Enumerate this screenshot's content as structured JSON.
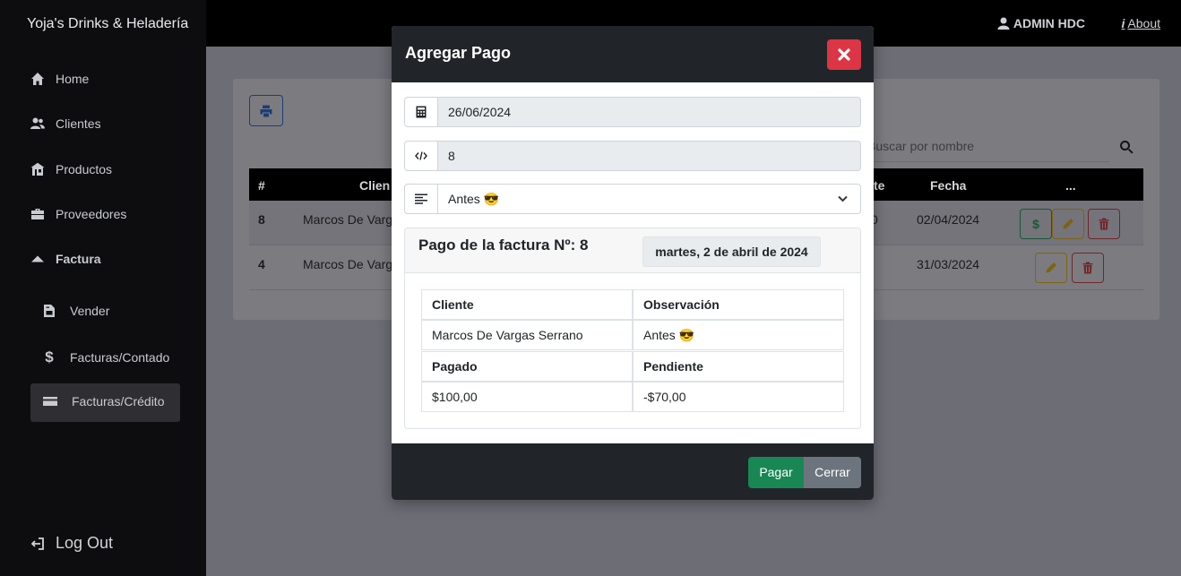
{
  "app": {
    "brand": "Yoja's Drinks & Heladería"
  },
  "topbar": {
    "user": "ADMIN HDC",
    "about": "About"
  },
  "sidebar": {
    "items": [
      {
        "label": "Home",
        "icon": "home-icon"
      },
      {
        "label": "Clientes",
        "icon": "users-icon"
      },
      {
        "label": "Productos",
        "icon": "store-icon"
      },
      {
        "label": "Proveedores",
        "icon": "briefcase-icon"
      },
      {
        "label": "Factura",
        "icon": "caret-up-icon"
      }
    ],
    "subitems": [
      {
        "label": "Vender",
        "icon": "file-invoice-icon"
      },
      {
        "label": "Facturas/Contado",
        "icon": "dollar-icon"
      },
      {
        "label": "Facturas/Crédito",
        "icon": "credit-card-icon",
        "active": true
      }
    ],
    "logout": "Log Out"
  },
  "background": {
    "search_placeholder": "Buscar por nombre",
    "columns": {
      "num": "#",
      "client": "Clien",
      "amount": "te",
      "date": "Fecha",
      "actions": "..."
    },
    "rows": [
      {
        "num": "8",
        "client": "Marcos De Varg",
        "amount": "0",
        "date": "02/04/2024"
      },
      {
        "num": "4",
        "client": "Marcos De Varg",
        "date": "31/03/2024"
      }
    ],
    "pay_action_label": "$"
  },
  "modal": {
    "title": "Agregar Pago",
    "date_value": "26/06/2024",
    "code_value": "8",
    "observation_selected": "Antes 😎",
    "invoice_title": "Pago de la factura Nº: 8",
    "invoice_date": "martes, 2 de abril de 2024",
    "table": {
      "client_header": "Cliente",
      "observation_header": "Observación",
      "client_value": "Marcos De Vargas Serrano",
      "observation_value": "Antes 😎",
      "paid_header": "Pagado",
      "pending_header": "Pendiente",
      "paid_value": "$100,00",
      "pending_value": "-$70,00"
    },
    "pay_label": "Pagar",
    "close_label": "Cerrar"
  },
  "colors": {
    "danger": "#dc3545",
    "success": "#198754",
    "secondary": "#6c757d",
    "dark": "#212529"
  }
}
